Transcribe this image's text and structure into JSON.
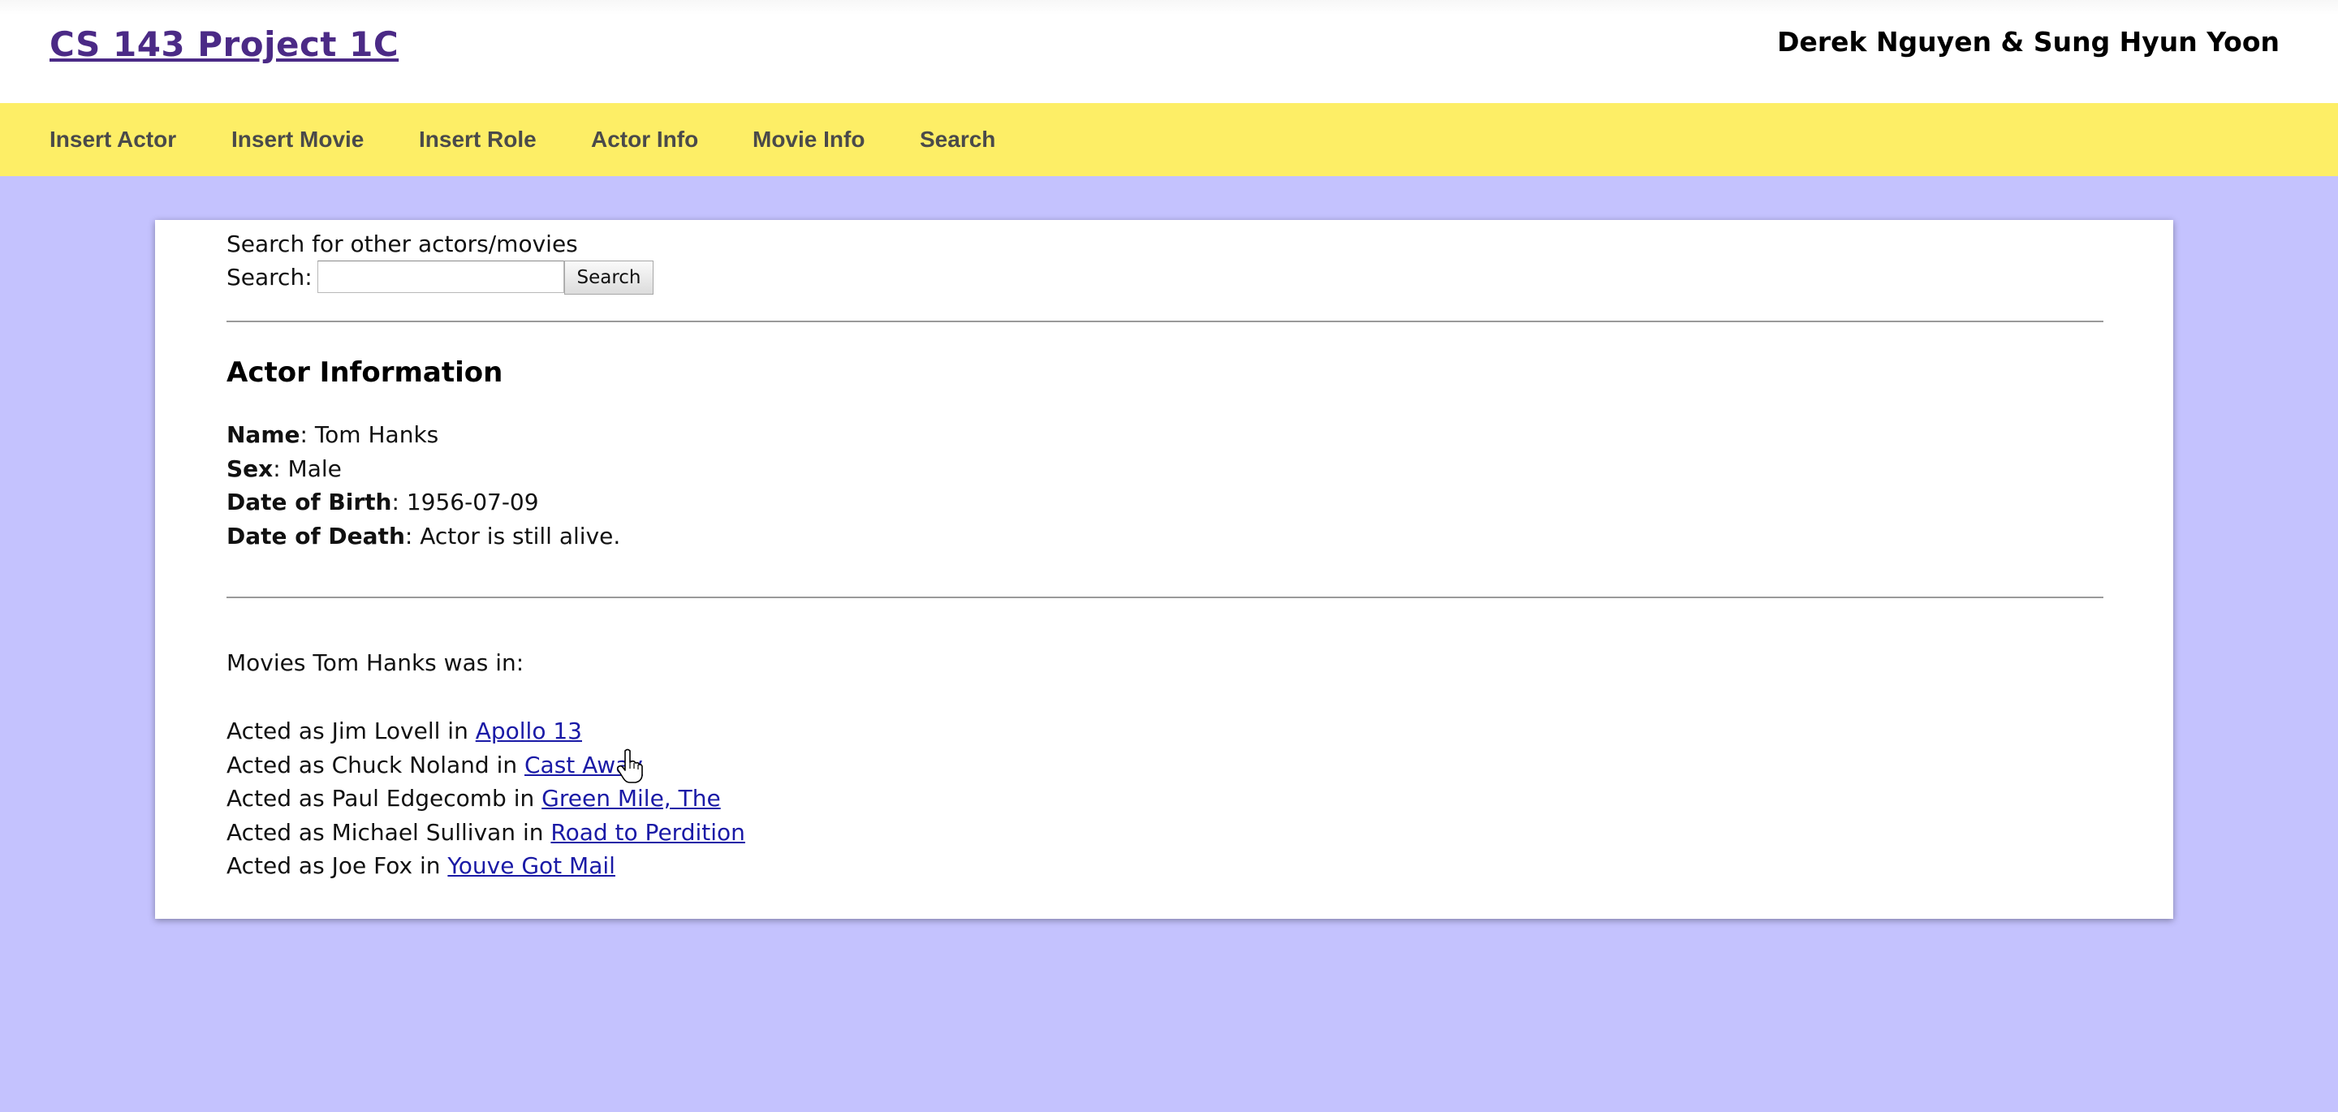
{
  "header": {
    "title": "CS 143 Project 1C",
    "authors": "Derek Nguyen & Sung Hyun Yoon"
  },
  "nav": {
    "items": [
      {
        "label": "Insert Actor"
      },
      {
        "label": "Insert Movie"
      },
      {
        "label": "Insert Role"
      },
      {
        "label": "Actor Info"
      },
      {
        "label": "Movie Info"
      },
      {
        "label": "Search"
      }
    ]
  },
  "search": {
    "prompt": "Search for other actors/movies",
    "label": "Search:",
    "value": "",
    "button_label": "Search"
  },
  "actor": {
    "heading": "Actor Information",
    "fields": [
      {
        "label": "Name",
        "value": ": Tom Hanks"
      },
      {
        "label": "Sex",
        "value": ": Male"
      },
      {
        "label": "Date of Birth",
        "value": ": 1956-07-09"
      },
      {
        "label": "Date of Death",
        "value": ": Actor is still alive."
      }
    ]
  },
  "movies": {
    "intro": "Movies Tom Hanks was in:",
    "roles": [
      {
        "prefix": "Acted as Jim Lovell in ",
        "title": "Apollo 13"
      },
      {
        "prefix": "Acted as Chuck Noland in ",
        "title": "Cast Away"
      },
      {
        "prefix": "Acted as Paul Edgecomb in ",
        "title": "Green Mile, The"
      },
      {
        "prefix": "Acted as Michael Sullivan in ",
        "title": "Road to Perdition"
      },
      {
        "prefix": "Acted as Joe Fox in ",
        "title": "Youve Got Mail"
      }
    ]
  },
  "colors": {
    "page_background": "#c4c2fe",
    "nav_background": "#fdee66",
    "title_link": "#4b2a86",
    "movie_link": "#1a1aa6"
  }
}
